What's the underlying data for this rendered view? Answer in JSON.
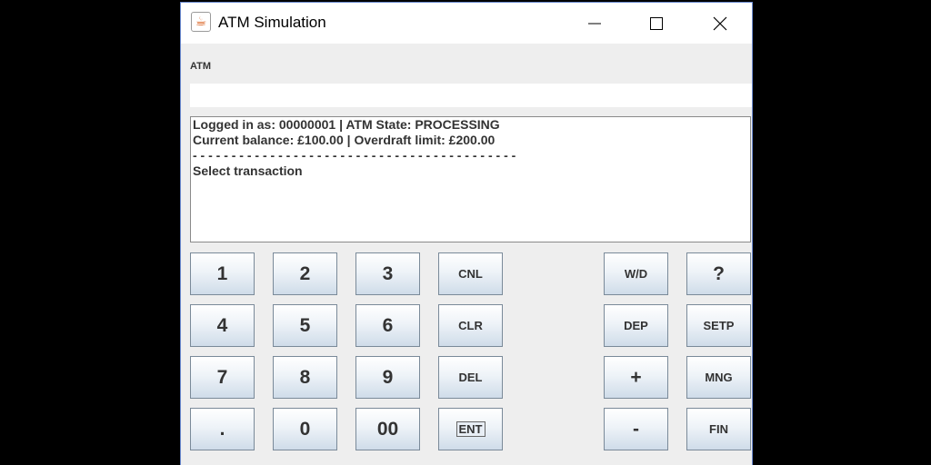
{
  "window": {
    "title": "ATM Simulation",
    "icon": "java-cup-icon",
    "controls": [
      "minimize",
      "maximize",
      "close"
    ]
  },
  "header": {
    "label": "ATM"
  },
  "input": {
    "value": ""
  },
  "display": {
    "lines": [
      "Logged in as: 00000001 | ATM State: PROCESSING",
      "Current balance: £100.00 | Overdraft limit: £200.00",
      "- - - - - - - - - - - - - - - - - - - - - - - - - - - - - - - - - - - - - - - - - -",
      "Select transaction"
    ]
  },
  "keypad": {
    "k1": "1",
    "k2": "2",
    "k3": "3",
    "k4": "4",
    "k5": "5",
    "k6": "6",
    "k7": "7",
    "k8": "8",
    "k9": "9",
    "kdot": ".",
    "k0": "0",
    "k00": "00",
    "cnl": "CNL",
    "clr": "CLR",
    "del": "DEL",
    "ent": "ENT"
  },
  "actions": {
    "wd": "W/D",
    "help": "?",
    "dep": "DEP",
    "setp": "SETP",
    "plus": "+",
    "mng": "MNG",
    "minus": "-",
    "fin": "FIN"
  }
}
